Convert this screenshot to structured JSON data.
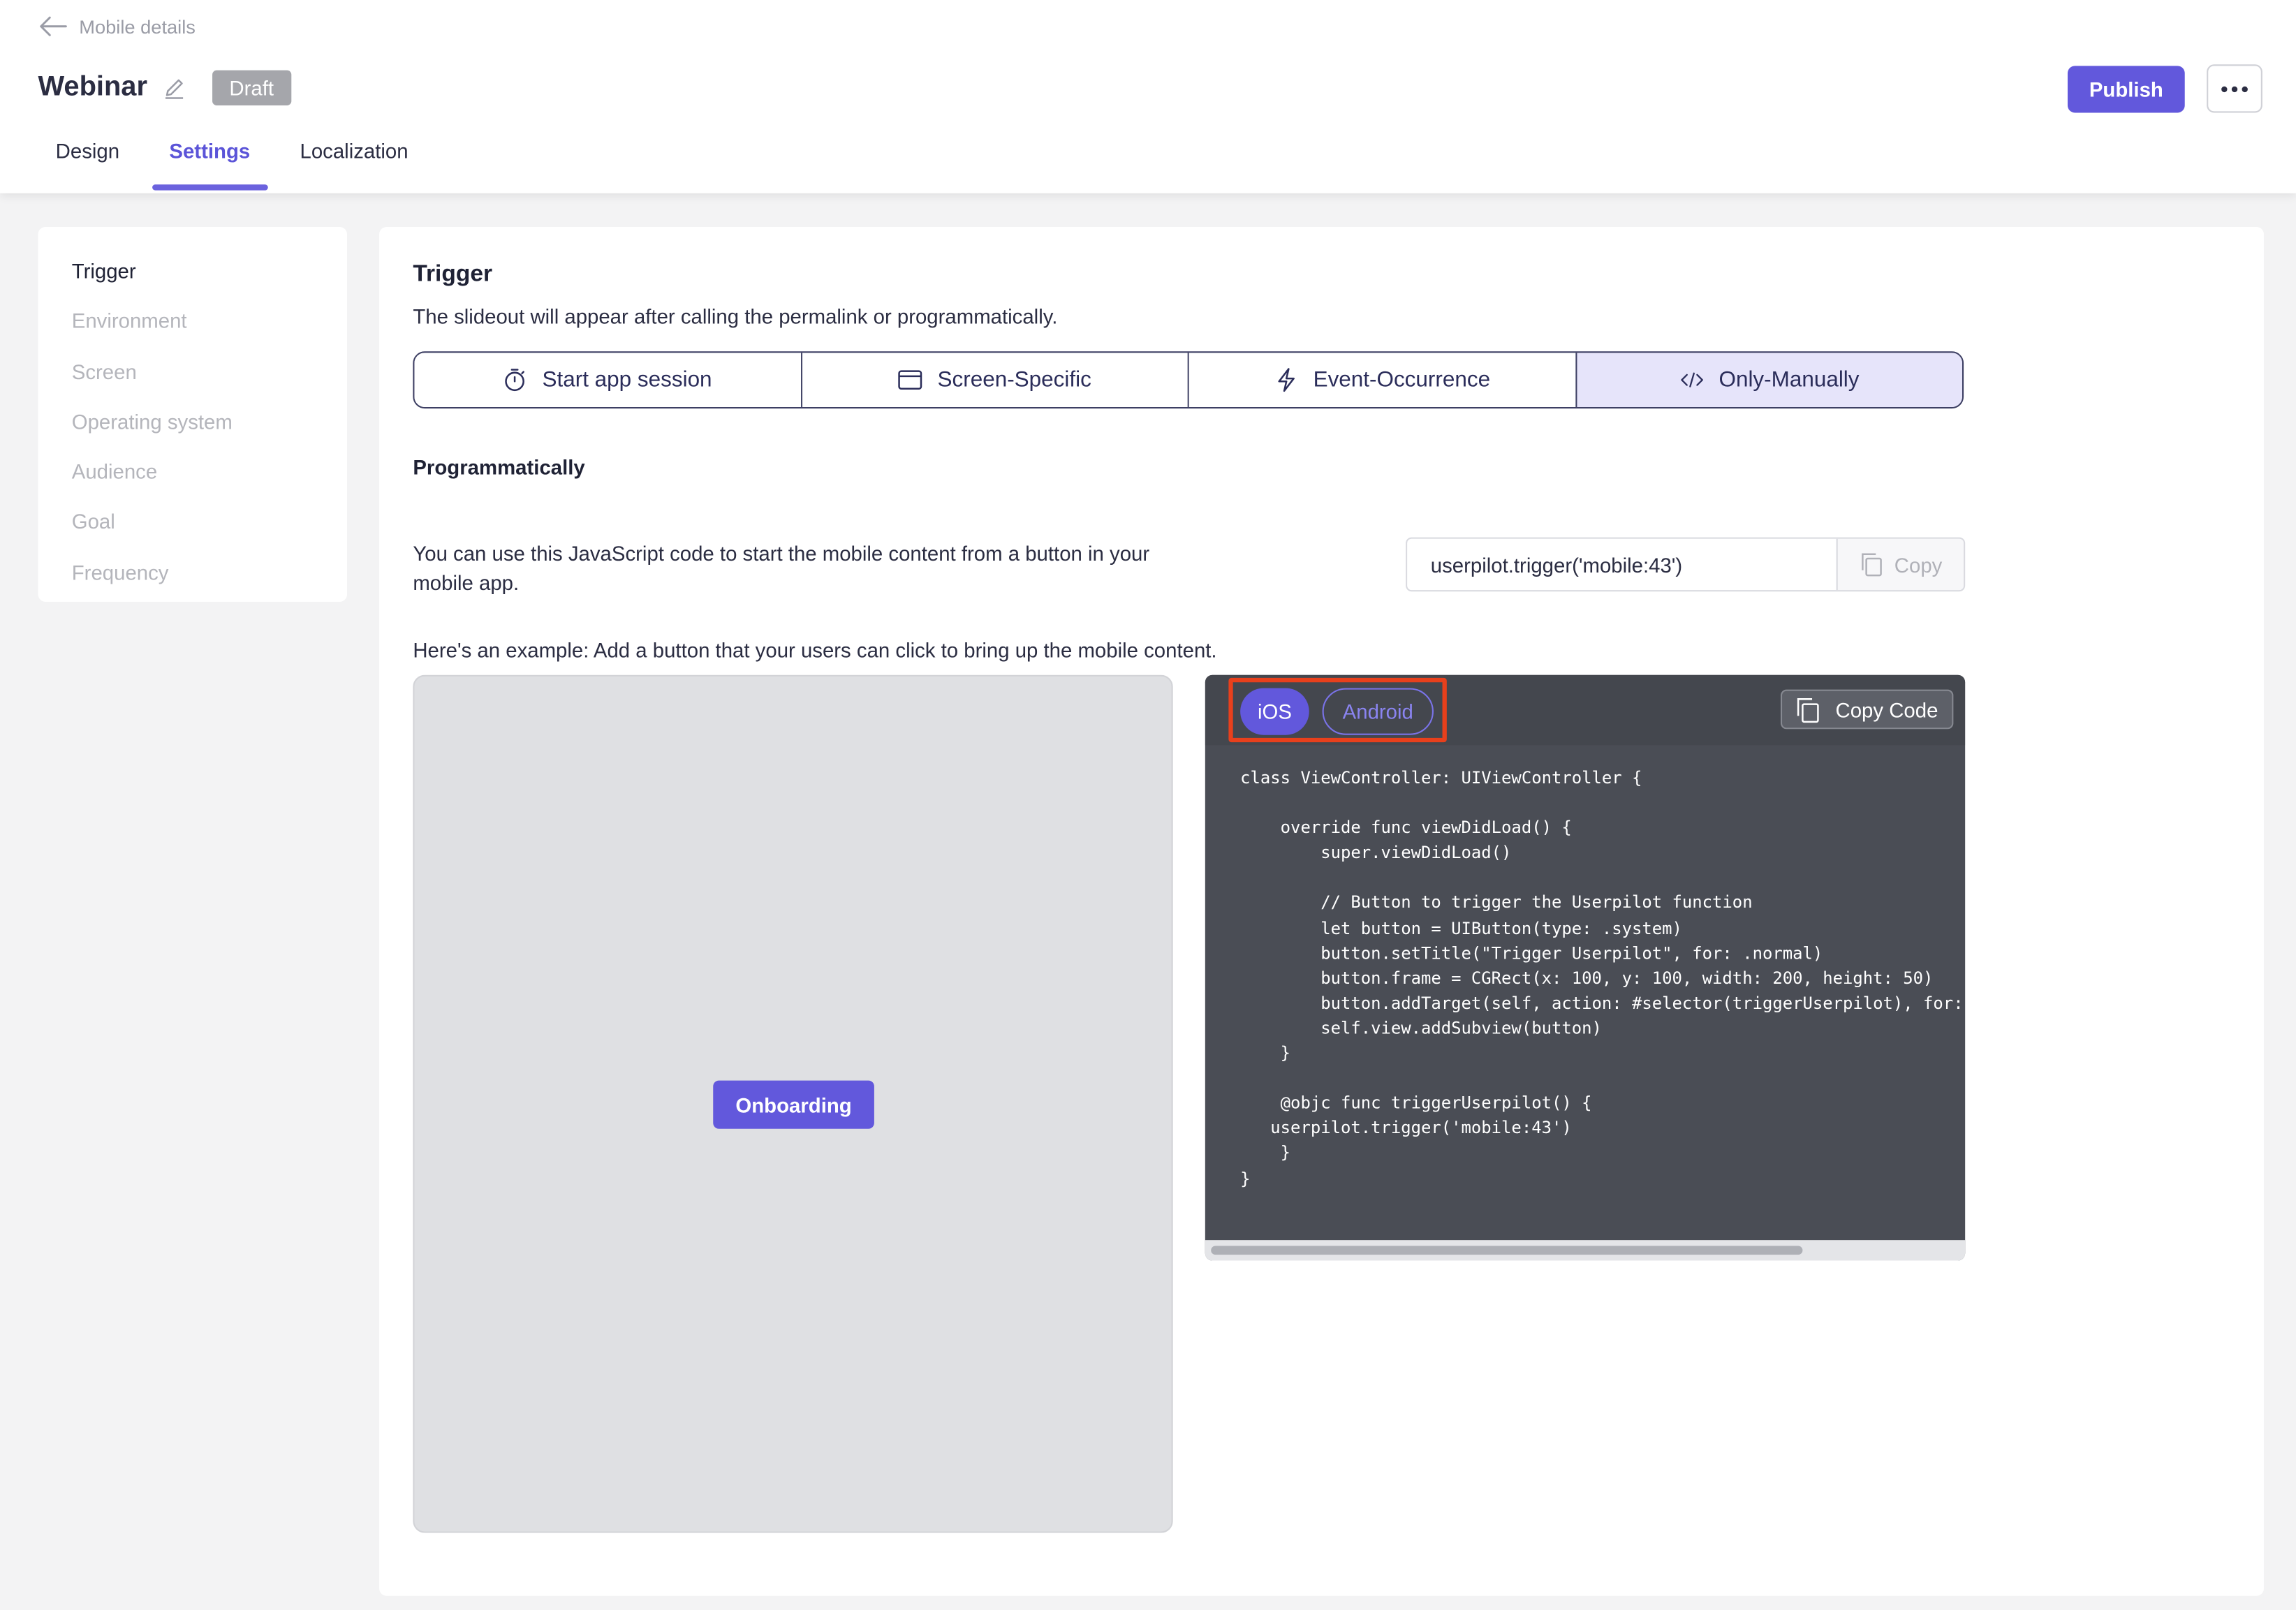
{
  "header": {
    "back_label": "Mobile details",
    "title": "Webinar",
    "status_badge": "Draft",
    "publish_label": "Publish",
    "tabs": [
      {
        "label": "Design",
        "active": false
      },
      {
        "label": "Settings",
        "active": true
      },
      {
        "label": "Localization",
        "active": false
      }
    ]
  },
  "sidebar": {
    "items": [
      {
        "label": "Trigger",
        "active": true
      },
      {
        "label": "Environment",
        "active": false
      },
      {
        "label": "Screen",
        "active": false
      },
      {
        "label": "Operating system",
        "active": false
      },
      {
        "label": "Audience",
        "active": false
      },
      {
        "label": "Goal",
        "active": false
      },
      {
        "label": "Frequency",
        "active": false
      }
    ]
  },
  "trigger": {
    "title": "Trigger",
    "description": "The slideout will appear after calling the permalink or programmatically.",
    "options": [
      {
        "label": "Start app session",
        "icon": "timer-icon"
      },
      {
        "label": "Screen-Specific",
        "icon": "browser-window-icon"
      },
      {
        "label": "Event-Occurrence",
        "icon": "lightning-icon"
      },
      {
        "label": "Only-Manually",
        "icon": "code-icon"
      }
    ],
    "selected": "Only-Manually"
  },
  "programmatically": {
    "title": "Programmatically",
    "description": "You can use this JavaScript code to start the mobile content from a button in your mobile app.",
    "snippet": "userpilot.trigger('mobile:43')",
    "copy_label": "Copy",
    "example_text": "Here's an example: Add a button that your users can click to bring up the mobile content."
  },
  "preview": {
    "button_label": "Onboarding"
  },
  "code_panel": {
    "platforms": [
      "iOS",
      "Android"
    ],
    "selected_platform": "iOS",
    "copy_code_label": "Copy Code",
    "code": "class ViewController: UIViewController {\n\n    override func viewDidLoad() {\n        super.viewDidLoad()\n\n        // Button to trigger the Userpilot function\n        let button = UIButton(type: .system)\n        button.setTitle(\"Trigger Userpilot\", for: .normal)\n        button.frame = CGRect(x: 100, y: 100, width: 200, height: 50)\n        button.addTarget(self, action: #selector(triggerUserpilot), for:\n        self.view.addSubview(button)\n    }\n\n    @objc func triggerUserpilot() {\n   userpilot.trigger('mobile:43')\n    }\n}",
    "highlight_color": "#e8401c"
  },
  "colors": {
    "accent": "#6258dc",
    "selected_segment_bg": "#e6e4fa",
    "code_bg": "#4a4d55"
  }
}
